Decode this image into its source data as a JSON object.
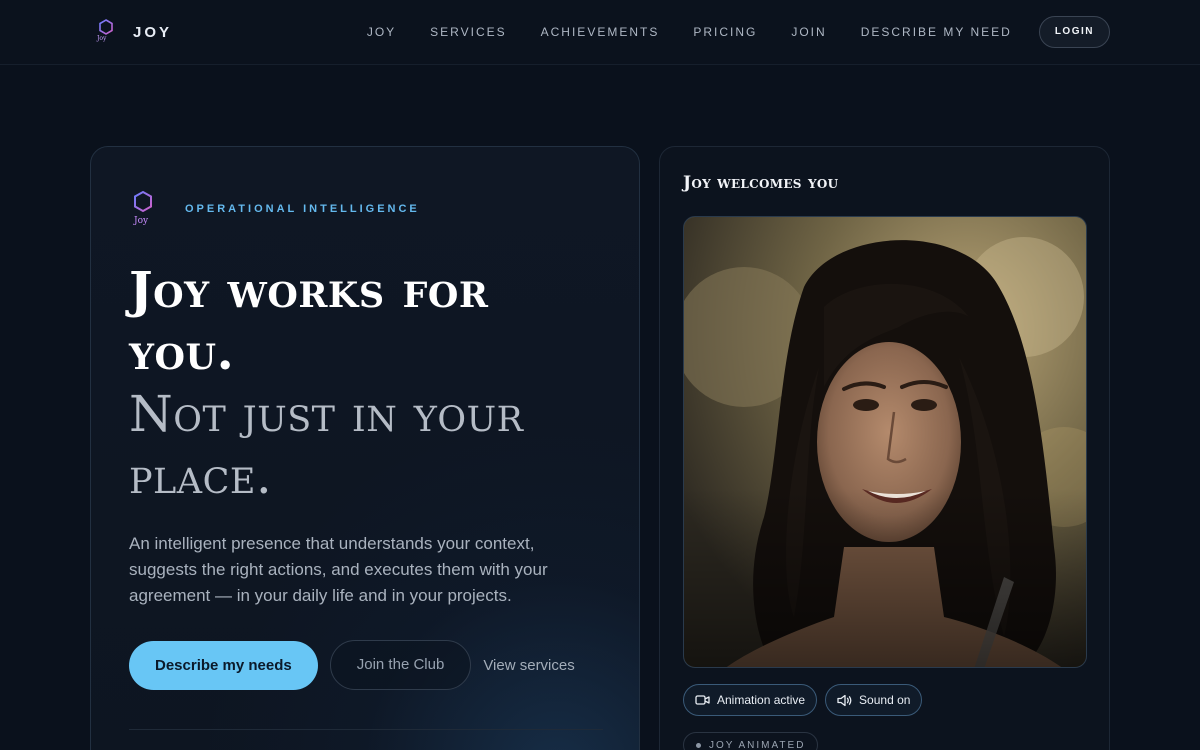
{
  "brand": {
    "name": "JOY",
    "logo_mini": "Joy"
  },
  "nav": {
    "items": [
      "JOY",
      "SERVICES",
      "ACHIEVEMENTS",
      "PRICING",
      "JOIN",
      "DESCRIBE MY NEED"
    ],
    "login_label": "LOGIN"
  },
  "hero": {
    "kicker": "OPERATIONAL INTELLIGENCE",
    "kicker_logo_mini": "Joy",
    "headline_main": "Joy works for you.",
    "headline_sub": "Not just in your place.",
    "description": "An intelligent presence that understands your context, suggests the right actions, and executes them with your agreement — in your daily life and in your projects.",
    "primary_cta": "Describe my needs",
    "secondary_cta": "Join the Club",
    "link_cta": "View services"
  },
  "video": {
    "title": "Joy welcomes you",
    "pills": [
      {
        "label": "Animation active",
        "icon": "video-camera-icon"
      },
      {
        "label": "Sound on",
        "icon": "speaker-icon"
      }
    ],
    "status": "JOY ANIMATED"
  },
  "colors": {
    "accent": "#68c6f5",
    "kicker": "#64b9ee",
    "background": "#0a111c",
    "logo_gradient_start": "#6a7dff",
    "logo_gradient_end": "#c060d8"
  }
}
